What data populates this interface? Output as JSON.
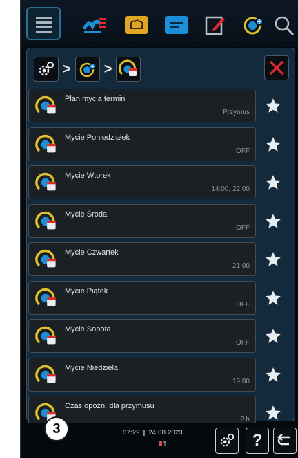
{
  "breadcrumb": {
    "separators": [
      ">",
      ">"
    ],
    "icons": [
      "settings-gears-icon",
      "cleaning-cycle-icon",
      "cleaning-schedule-icon"
    ]
  },
  "top_nav": {
    "icons": [
      "menu-icon",
      "cooking-modes-icon",
      "recipes-icon",
      "programs-icon",
      "notes-edit-icon",
      "cleaning-icon",
      "search-icon"
    ],
    "accent": "#2d6f93"
  },
  "items": [
    {
      "label": "Plan mycia termin",
      "value": "Przymus"
    },
    {
      "label": "Mycie Poniedziałek",
      "value": "OFF"
    },
    {
      "label": "Mycie Wtorek",
      "value": "14:00, 22:00"
    },
    {
      "label": "Mycie Środa",
      "value": "OFF"
    },
    {
      "label": "Mycie Czwartek",
      "value": "21:00"
    },
    {
      "label": "Mycie Piątek",
      "value": "OFF"
    },
    {
      "label": "Mycie Sobota",
      "value": "OFF"
    },
    {
      "label": "Mycie Niedziela",
      "value": "19:00"
    },
    {
      "label": "Czas opóźn. dla przymusu",
      "value": "2 h"
    }
  ],
  "footer": {
    "badge": "3",
    "time": "07:29",
    "divider": "|",
    "date": "24.08.2023",
    "help_label": "?"
  },
  "colors": {
    "close": "#e02b2b",
    "cleaning_icon_yellow": "#e1c22a",
    "cleaning_icon_blue": "#1d8fd6"
  }
}
